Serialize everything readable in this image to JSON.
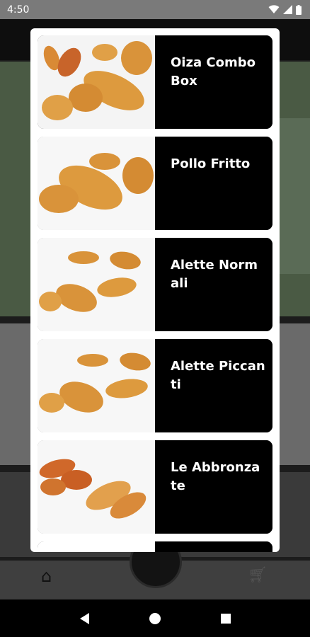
{
  "status_bar": {
    "time": "4:50"
  },
  "products": [
    {
      "name": "Oiza Combo Box",
      "image_icon": "fried-chicken-combo"
    },
    {
      "name": "Pollo Fritto",
      "image_icon": "fried-chicken-drumsticks"
    },
    {
      "name": "Alette Normali",
      "image_icon": "fried-wings"
    },
    {
      "name": "Alette Piccanti",
      "image_icon": "spicy-fried-wings"
    },
    {
      "name": "Le Abbronzate",
      "image_icon": "tanned-wings"
    },
    {
      "name": "",
      "image_icon": "food-item"
    }
  ],
  "system_nav": {
    "back": "back-icon",
    "home": "home-icon",
    "recents": "recents-icon"
  },
  "colors": {
    "card_text_bg": "#000000",
    "modal_bg": "#ffffff",
    "chicken": "#d9933a"
  }
}
